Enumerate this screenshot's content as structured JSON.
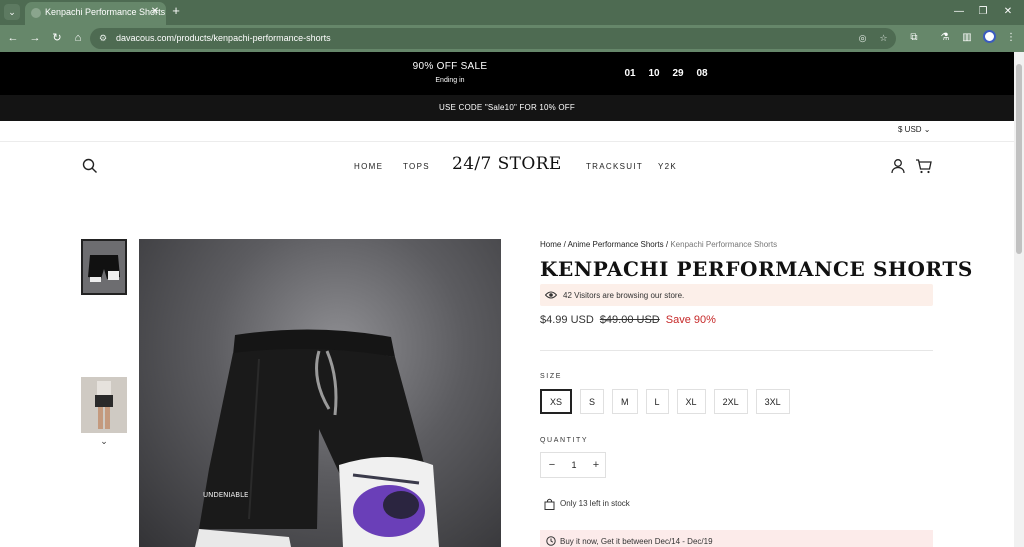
{
  "browser": {
    "tab_title": "Kenpachi Performance Shorts",
    "url": "davacous.com/products/kenpachi-performance-shorts"
  },
  "promo": {
    "title": "90% OFF SALE",
    "subtitle": "Ending in",
    "countdown": [
      "01",
      "10",
      "29",
      "08"
    ],
    "code_text": "USE CODE \"Sale10\" FOR 10% OFF"
  },
  "header": {
    "currency": "$ USD",
    "nav_left": [
      "HOME",
      "TOPS"
    ],
    "logo": "24/7 STORE",
    "nav_right": [
      "TRACKSUIT",
      "Y2K"
    ]
  },
  "product_image": {
    "shorts_text": "UNDENIABLE"
  },
  "product": {
    "breadcrumb": {
      "home": "Home",
      "sep": "/",
      "category": "Anime Performance Shorts",
      "current": "Kenpachi Performance Shorts"
    },
    "title": "KENPACHI PERFORMANCE SHORTS",
    "visitors_text": "42 Visitors are browsing our store.",
    "price": "$4.99 USD",
    "compare_price": "$49.00 USD",
    "save_text": "Save 90%",
    "size_label": "SIZE",
    "sizes": [
      "XS",
      "S",
      "M",
      "L",
      "XL",
      "2XL",
      "3XL"
    ],
    "selected_size": "XS",
    "quantity_label": "QUANTITY",
    "quantity": "1",
    "qty_minus": "−",
    "qty_plus": "+",
    "stock_text": "Only 13 left in stock",
    "shipping_text": "Buy it now, Get it between Dec/14 - Dec/19"
  },
  "colors": {
    "browser_frame": "#4e6b52",
    "promo_bg": "#000000",
    "sale_red": "#c62828",
    "visitors_bg": "#fcefe9"
  }
}
